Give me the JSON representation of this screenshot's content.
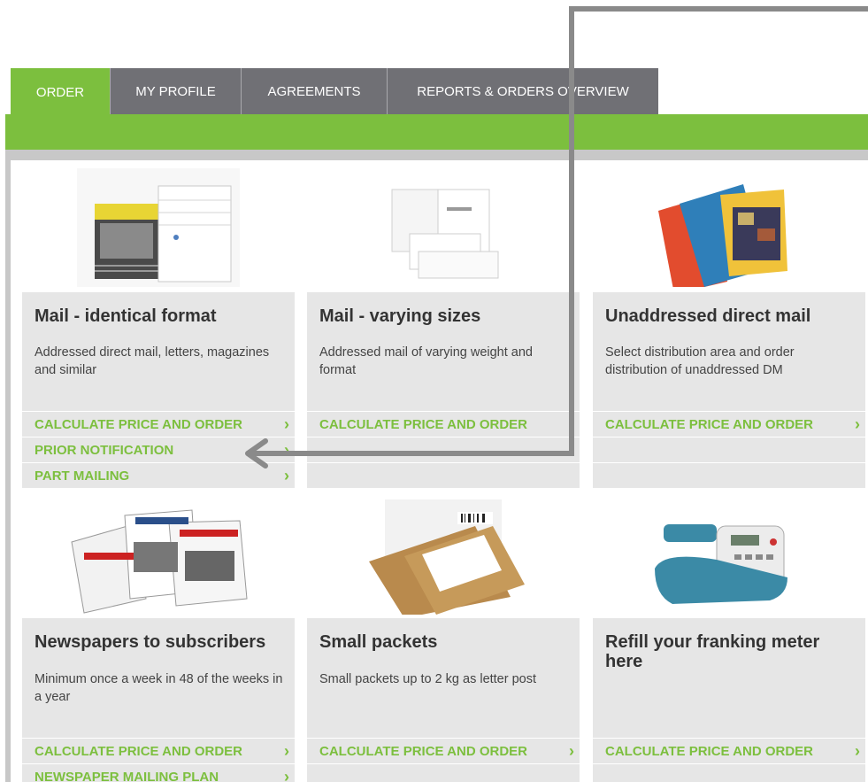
{
  "tabs": [
    {
      "label": "ORDER",
      "active": true
    },
    {
      "label": "MY PROFILE",
      "active": false
    },
    {
      "label": "AGREEMENTS",
      "active": false
    },
    {
      "label": "REPORTS & ORDERS OVERVIEW",
      "active": false
    }
  ],
  "cards": [
    {
      "title": "Mail - identical format",
      "description": "Addressed direct mail, letters, magazines and similar",
      "image": "stack-of-mail-icon",
      "links": [
        "CALCULATE PRICE AND ORDER",
        "PRIOR NOTIFICATION",
        "PART MAILING"
      ]
    },
    {
      "title": "Mail - varying sizes",
      "description": "Addressed mail of varying weight and format",
      "image": "envelopes-icon",
      "links": [
        "CALCULATE PRICE AND ORDER"
      ]
    },
    {
      "title": "Unaddressed direct mail",
      "description": "Select distribution area and order distribution of unaddressed DM",
      "image": "brochures-icon",
      "links": [
        "CALCULATE PRICE AND ORDER"
      ]
    },
    {
      "title": "Newspapers to subscribers",
      "description": "Minimum once a week in 48 of the weeks in a year",
      "image": "newspapers-icon",
      "links": [
        "CALCULATE PRICE AND ORDER",
        "NEWSPAPER MAILING PLAN"
      ]
    },
    {
      "title": "Small packets",
      "description": "Small packets up to 2 kg as letter post",
      "image": "packets-icon",
      "links": [
        "CALCULATE PRICE AND ORDER"
      ]
    },
    {
      "title": "Refill your franking meter here",
      "description": "",
      "image": "franking-meter-icon",
      "links": [
        "CALCULATE PRICE AND ORDER"
      ]
    }
  ],
  "colors": {
    "accent": "#7cbf3e",
    "tab_inactive": "#707075",
    "card_bg": "#e6e6e6",
    "annotation_arrow": "#8a8a8a"
  }
}
